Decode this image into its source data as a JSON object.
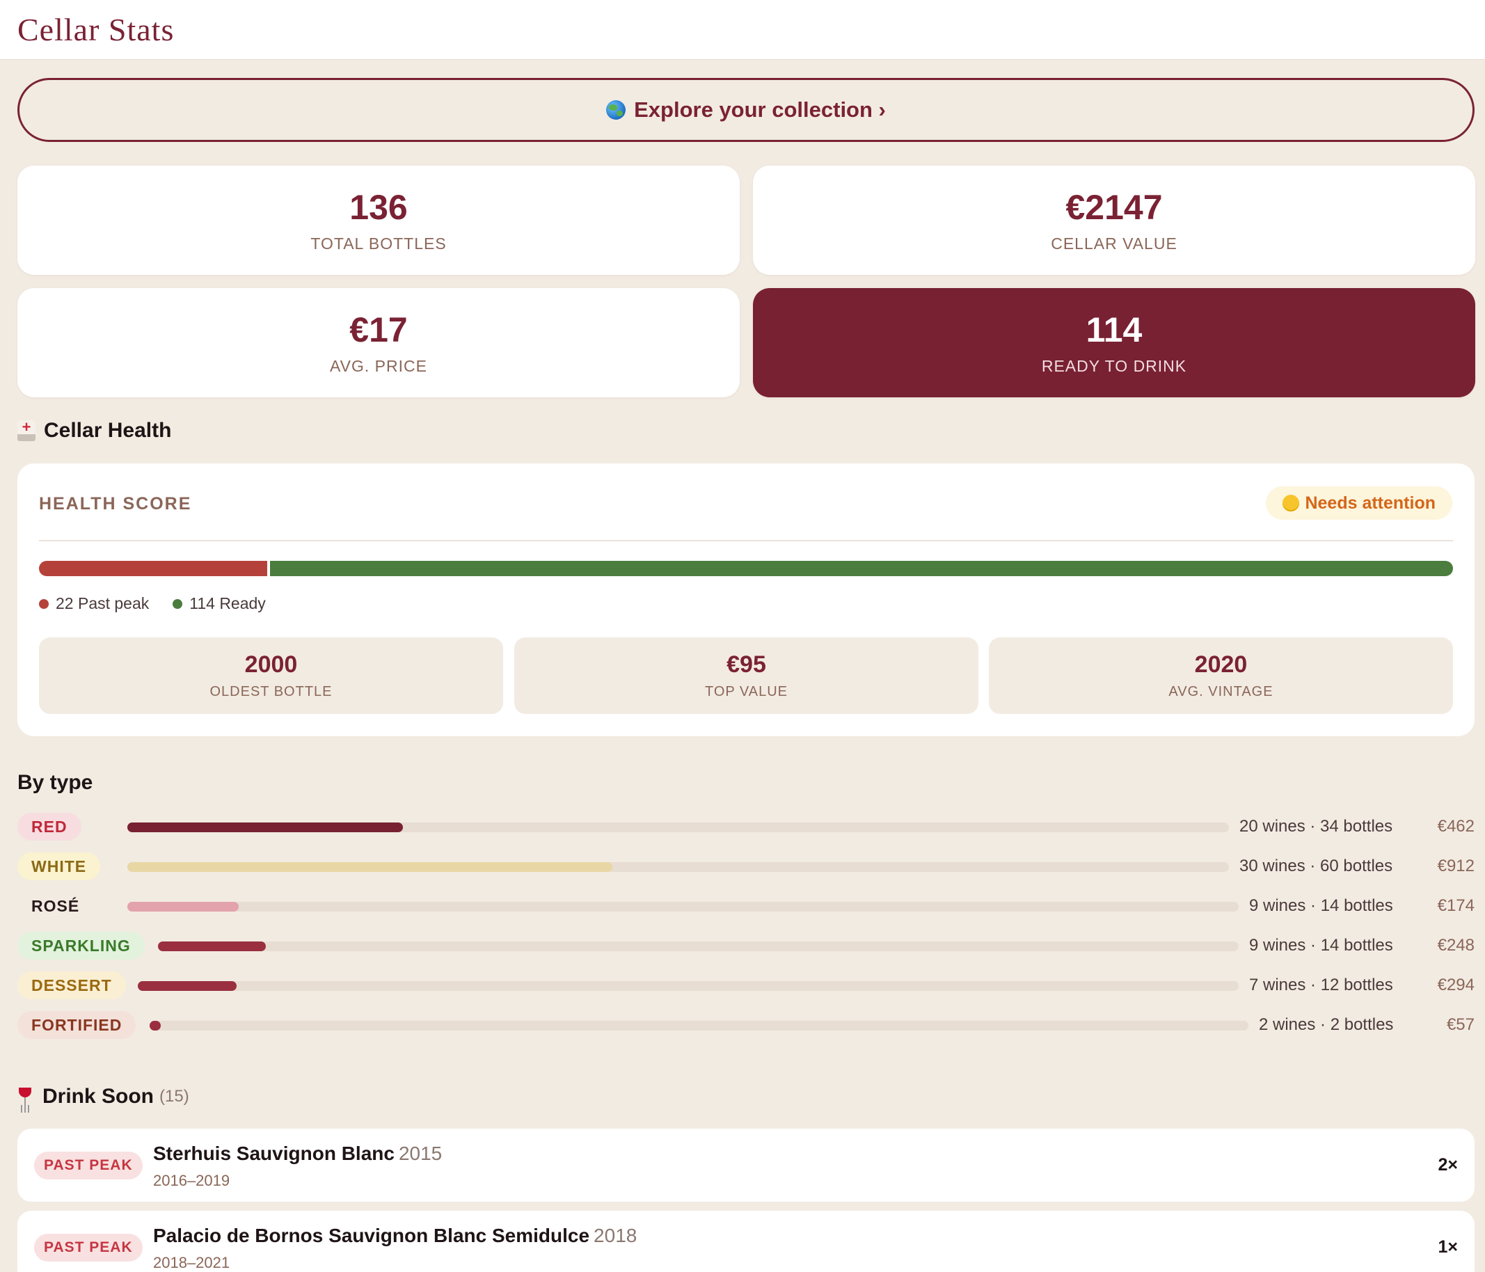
{
  "header": {
    "title": "Cellar Stats"
  },
  "explore": {
    "label": "Explore your collection ›",
    "icon": "globe-icon"
  },
  "stats": {
    "total_bottles": {
      "value": "136",
      "label": "TOTAL BOTTLES"
    },
    "cellar_value": {
      "value": "€2147",
      "label": "CELLAR VALUE"
    },
    "avg_price": {
      "value": "€17",
      "label": "AVG. PRICE"
    },
    "ready": {
      "value": "114",
      "label": "READY TO DRINK"
    }
  },
  "health": {
    "heading": "Cellar Health",
    "score_label": "HEALTH SCORE",
    "status": "Needs attention",
    "past_peak": 22,
    "ready": 114,
    "legend_past_peak": "22 Past peak",
    "legend_ready": "114 Ready",
    "colors": {
      "past_peak": "#b5423a",
      "ready": "#4a7d3e"
    },
    "mini": [
      {
        "value": "2000",
        "label": "OLDEST BOTTLE"
      },
      {
        "value": "€95",
        "label": "TOP VALUE"
      },
      {
        "value": "2020",
        "label": "AVG. VINTAGE"
      }
    ]
  },
  "by_type": {
    "heading": "By type",
    "rows": [
      {
        "label": "RED",
        "fraction": 0.25,
        "counts": "20 wines · 34 bottles",
        "price": "€462",
        "color": "#782133",
        "pill_bg": "#f7dde0",
        "pill_fg": "#c0283a"
      },
      {
        "label": "WHITE",
        "fraction": 0.44,
        "counts": "30 wines · 60 bottles",
        "price": "€912",
        "color": "#e8d6a4",
        "pill_bg": "#fbf2cf",
        "pill_fg": "#8a6b16"
      },
      {
        "label": "ROSÉ",
        "fraction": 0.1,
        "counts": "9 wines · 14 bottles",
        "price": "€174",
        "color": "#e3a3ac",
        "pill_bg": "transparent",
        "pill_fg": "#2a1a1c"
      },
      {
        "label": "SPARKLING",
        "fraction": 0.1,
        "counts": "9 wines · 14 bottles",
        "price": "€248",
        "color": "#9a2f3f",
        "pill_bg": "#e2f2dd",
        "pill_fg": "#3a7a2a"
      },
      {
        "label": "DESSERT",
        "fraction": 0.09,
        "counts": "7 wines · 12 bottles",
        "price": "€294",
        "color": "#9a2f3f",
        "pill_bg": "#fbefd3",
        "pill_fg": "#9a6a10"
      },
      {
        "label": "FORTIFIED",
        "fraction": 0.01,
        "counts": "2 wines · 2 bottles",
        "price": "€57",
        "color": "#9a2f3f",
        "pill_bg": "#f3e1da",
        "pill_fg": "#8a3520"
      }
    ]
  },
  "drink_soon": {
    "heading": "Drink Soon",
    "count": "(15)",
    "items": [
      {
        "badge": "PAST PEAK",
        "name": "Sterhuis Sauvignon Blanc",
        "vintage": "2015",
        "window": "2016–2019",
        "qty": "2×"
      },
      {
        "badge": "PAST PEAK",
        "name": "Palacio de Bornos Sauvignon Blanc Semidulce",
        "vintage": "2018",
        "window": "2018–2021",
        "qty": "1×"
      }
    ]
  }
}
